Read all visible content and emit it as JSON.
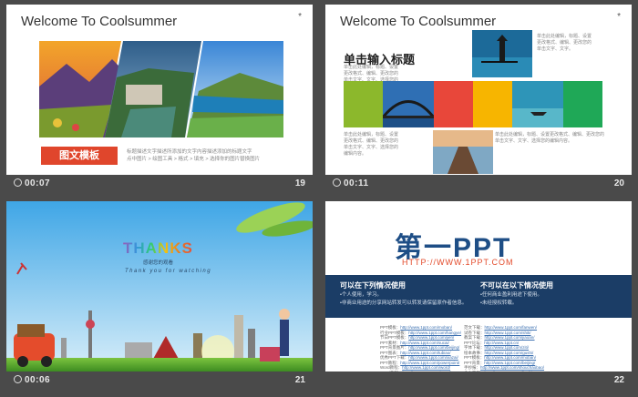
{
  "slides": [
    {
      "title": "Welcome To Coolsummer",
      "star": "*",
      "button": "图文模板",
      "text_lines": [
        "标题描述文字描述所添加的文字内容描述添加的标题文字",
        "点中图片 > 绘图工具 > 格式 > 填充 > 选择你的图片替换图片"
      ],
      "time": "00:07",
      "number": "19"
    },
    {
      "title": "Welcome To Coolsummer",
      "star": "*",
      "heading": "单击输入标题",
      "para_a": "单击此处编辑，标题、设置更改格式、编辑、更改您的单击文字、文字、选择您的编辑内容。",
      "para_b": "单击此处编辑，标题、设置更改格式、编辑、更改您的单击文字、文字。",
      "para_c": "单击此处编辑，标题、设置更改格式、编辑、更改您的单击文字、文字、选择您的编辑内容。",
      "para_d": "单击此处编辑，标题、设置更改格式、编辑、更改您的单击文字、文字、选择您的编辑内容。",
      "time": "00:11",
      "number": "20"
    },
    {
      "thanks": "THANKS",
      "sub": "感谢您的观看",
      "tagline": "Thank you for watching",
      "time": "00:06",
      "number": "21"
    },
    {
      "logo_a": "第一",
      "logo_b": "PPT",
      "url": "HTTP://WWW.1PPT.COM",
      "left_heading": "可以在下列情况使用",
      "left_lines": [
        "•个人使用，学习。",
        "•非商业用途的分享网站转发可以转发请保留原作者信息。"
      ],
      "right_heading": "不可以在以下情况使用",
      "right_lines": [
        "•任何商业盈利用途下使用。",
        "•未经授权转载。"
      ],
      "links_left": [
        [
          "PPT模板",
          "http://www.1ppt.com/moban/"
        ],
        [
          "行业PPT模板",
          "http://www.1ppt.com/hangye/"
        ],
        [
          "节日PPT模板",
          "http://www.1ppt.com/jieri/"
        ],
        [
          "PPT素材",
          "http://www.1ppt.com/sucai/"
        ],
        [
          "PPT背景图片",
          "http://www.1ppt.com/beijing/"
        ],
        [
          "PPT图表",
          "http://www.1ppt.com/tubiao/"
        ],
        [
          "优秀PPT下载",
          "http://www.1ppt.com/xiazai/"
        ],
        [
          "PPT教程",
          "http://www.1ppt.com/powerpoint/"
        ],
        [
          "Word教程",
          "http://www.1ppt.com/word/"
        ],
        [
          "Excel教程",
          "http://www.1ppt.com/excel/"
        ],
        [
          "资料下载",
          "http://www.1ppt.com/ziliao/"
        ],
        [
          "PPT课件",
          "http://www.1ppt.com/kejian/"
        ]
      ],
      "links_right": [
        [
          "范文下载",
          "http://www.1ppt.com/fanwen/"
        ],
        [
          "试卷下载",
          "http://www.1ppt.com/shiti/"
        ],
        [
          "教案下载",
          "http://www.1ppt.com/jiaoan/"
        ],
        [
          "PPT论坛",
          "http://www.1ppt.cn/"
        ],
        [
          "字体下载",
          "http://www.1ppt.com/ziti/"
        ],
        [
          "绘本故事",
          "http://www.1ppt.com/gushi/"
        ],
        [
          "PPT模板",
          "http://www.1ppt.com/moban/"
        ],
        [
          "PPT背景",
          "http://www.1ppt.com/beijing/"
        ],
        [
          "手抄报",
          "http://www.1ppt.com/shouchaobao/"
        ],
        [
          "个人简历",
          "http://www.1ppt.com/jianli/"
        ],
        [
          "教学计划",
          "http://www.1ppt.com/jiaoxue/"
        ],
        [
          "工作总结",
          "http://www.1ppt.com/zongjie/"
        ]
      ],
      "number": "22"
    }
  ]
}
